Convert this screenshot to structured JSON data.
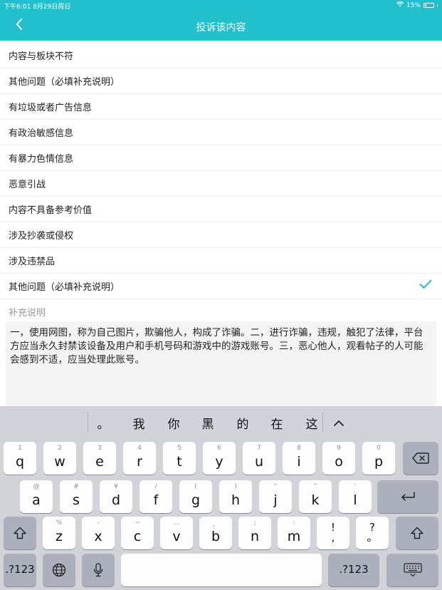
{
  "status_bar": {
    "time_date": "下午6:01  8月29日周日",
    "battery": "15%"
  },
  "nav": {
    "title": "投诉该内容"
  },
  "reasons": [
    {
      "label": "内容与板块不符",
      "selected": false
    },
    {
      "label": "其他问题（必填补充说明）",
      "selected": false
    },
    {
      "label": "有垃圾或者广告信息",
      "selected": false
    },
    {
      "label": "有政治敏感信息",
      "selected": false
    },
    {
      "label": "有暴力色情信息",
      "selected": false
    },
    {
      "label": "恶意引战",
      "selected": false
    },
    {
      "label": "内容不具备参考价值",
      "selected": false
    },
    {
      "label": "涉及抄袭或侵权",
      "selected": false
    },
    {
      "label": "涉及违禁品",
      "selected": false
    },
    {
      "label": "其他问题（必填补充说明）",
      "selected": true
    }
  ],
  "supplement": {
    "label": "补充说明",
    "text": "一，使用网图，称为自己图片，欺骗他人，构成了诈骗。二，进行诈骗，违规，触犯了法律，平台方应当永久封禁该设备及用户和手机号码和游戏中的游戏账号。三，恶心他人，观看帖子的人可能会感到不适，应当处理此账号。"
  },
  "colors": {
    "accent": "#22c0cc",
    "keyboard_bg": "#d1d3d9"
  },
  "keyboard": {
    "candidates": [
      "。",
      "我",
      "你",
      "黑",
      "的",
      "在",
      "这"
    ],
    "row1": [
      {
        "hint": "1",
        "key": "q"
      },
      {
        "hint": "2",
        "key": "w"
      },
      {
        "hint": "3",
        "key": "e"
      },
      {
        "hint": "4",
        "key": "r"
      },
      {
        "hint": "5",
        "key": "t"
      },
      {
        "hint": "6",
        "key": "y"
      },
      {
        "hint": "7",
        "key": "u"
      },
      {
        "hint": "8",
        "key": "i"
      },
      {
        "hint": "9",
        "key": "o"
      },
      {
        "hint": "0",
        "key": "p"
      }
    ],
    "row2": [
      {
        "hint": "@",
        "key": "a"
      },
      {
        "hint": "#",
        "key": "s"
      },
      {
        "hint": "¥",
        "key": "d"
      },
      {
        "hint": "/",
        "key": "f"
      },
      {
        "hint": "(",
        "key": "g"
      },
      {
        "hint": ")",
        "key": "h"
      },
      {
        "hint": "“",
        "key": "j"
      },
      {
        "hint": "”",
        "key": "k"
      },
      {
        "hint": "'",
        "key": "l"
      }
    ],
    "row3": [
      {
        "hint": "%",
        "key": "z"
      },
      {
        "hint": "-",
        "key": "x"
      },
      {
        "hint": "~",
        "key": "c"
      },
      {
        "hint": "…",
        "key": "v"
      },
      {
        "hint": "、",
        "key": "b"
      },
      {
        "hint": ";",
        "key": "n"
      },
      {
        "hint": ":",
        "key": "m"
      },
      {
        "hint": "",
        "key": "!\n,"
      },
      {
        "hint": "",
        "key": "?\n。"
      }
    ],
    "num_label": ".?123"
  }
}
